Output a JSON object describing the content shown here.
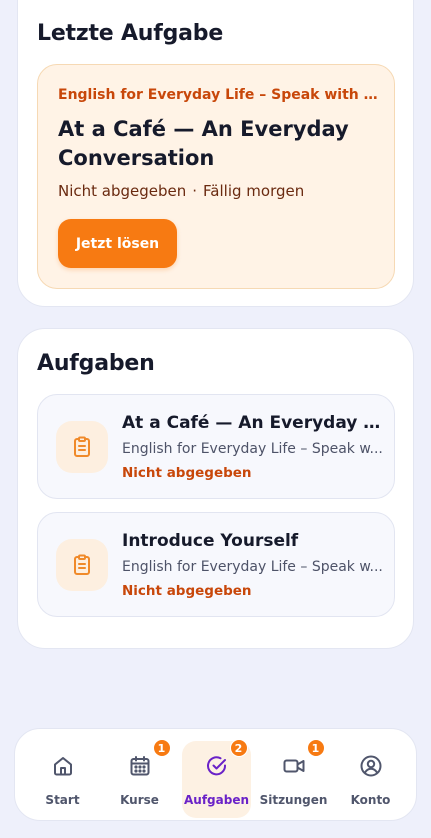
{
  "latest": {
    "heading": "Letzte Aufgabe",
    "course": "English for Everyday Life – Speak with Con...",
    "title": "At a Café — An Everyday Conversation",
    "status": "Nicht abgegeben",
    "separator": "·",
    "due": "Fällig morgen",
    "solve_label": "Jetzt lösen"
  },
  "tasks": {
    "heading": "Aufgaben",
    "items": [
      {
        "title": "At a Café — An Everyday Co...",
        "course": "English for Everyday Life – Speak w...",
        "status": "Nicht abgegeben",
        "icon": "clipboard-icon"
      },
      {
        "title": "Introduce Yourself",
        "course": "English for Everyday Life – Speak w...",
        "status": "Nicht abgegeben",
        "icon": "clipboard-icon"
      }
    ]
  },
  "nav": {
    "items": [
      {
        "label": "Start",
        "icon": "home-icon",
        "badge": null,
        "active": false
      },
      {
        "label": "Kurse",
        "icon": "calendar-icon",
        "badge": "1",
        "active": false
      },
      {
        "label": "Aufgaben",
        "icon": "check-circle-icon",
        "badge": "2",
        "active": true
      },
      {
        "label": "Sitzungen",
        "icon": "video-icon",
        "badge": "1",
        "active": false
      },
      {
        "label": "Konto",
        "icon": "user-circle-icon",
        "badge": null,
        "active": false
      }
    ]
  },
  "colors": {
    "accent": "#f77a12",
    "status_text": "#c8470a",
    "active_nav": "#6a22c8",
    "background": "#eef0fb"
  }
}
